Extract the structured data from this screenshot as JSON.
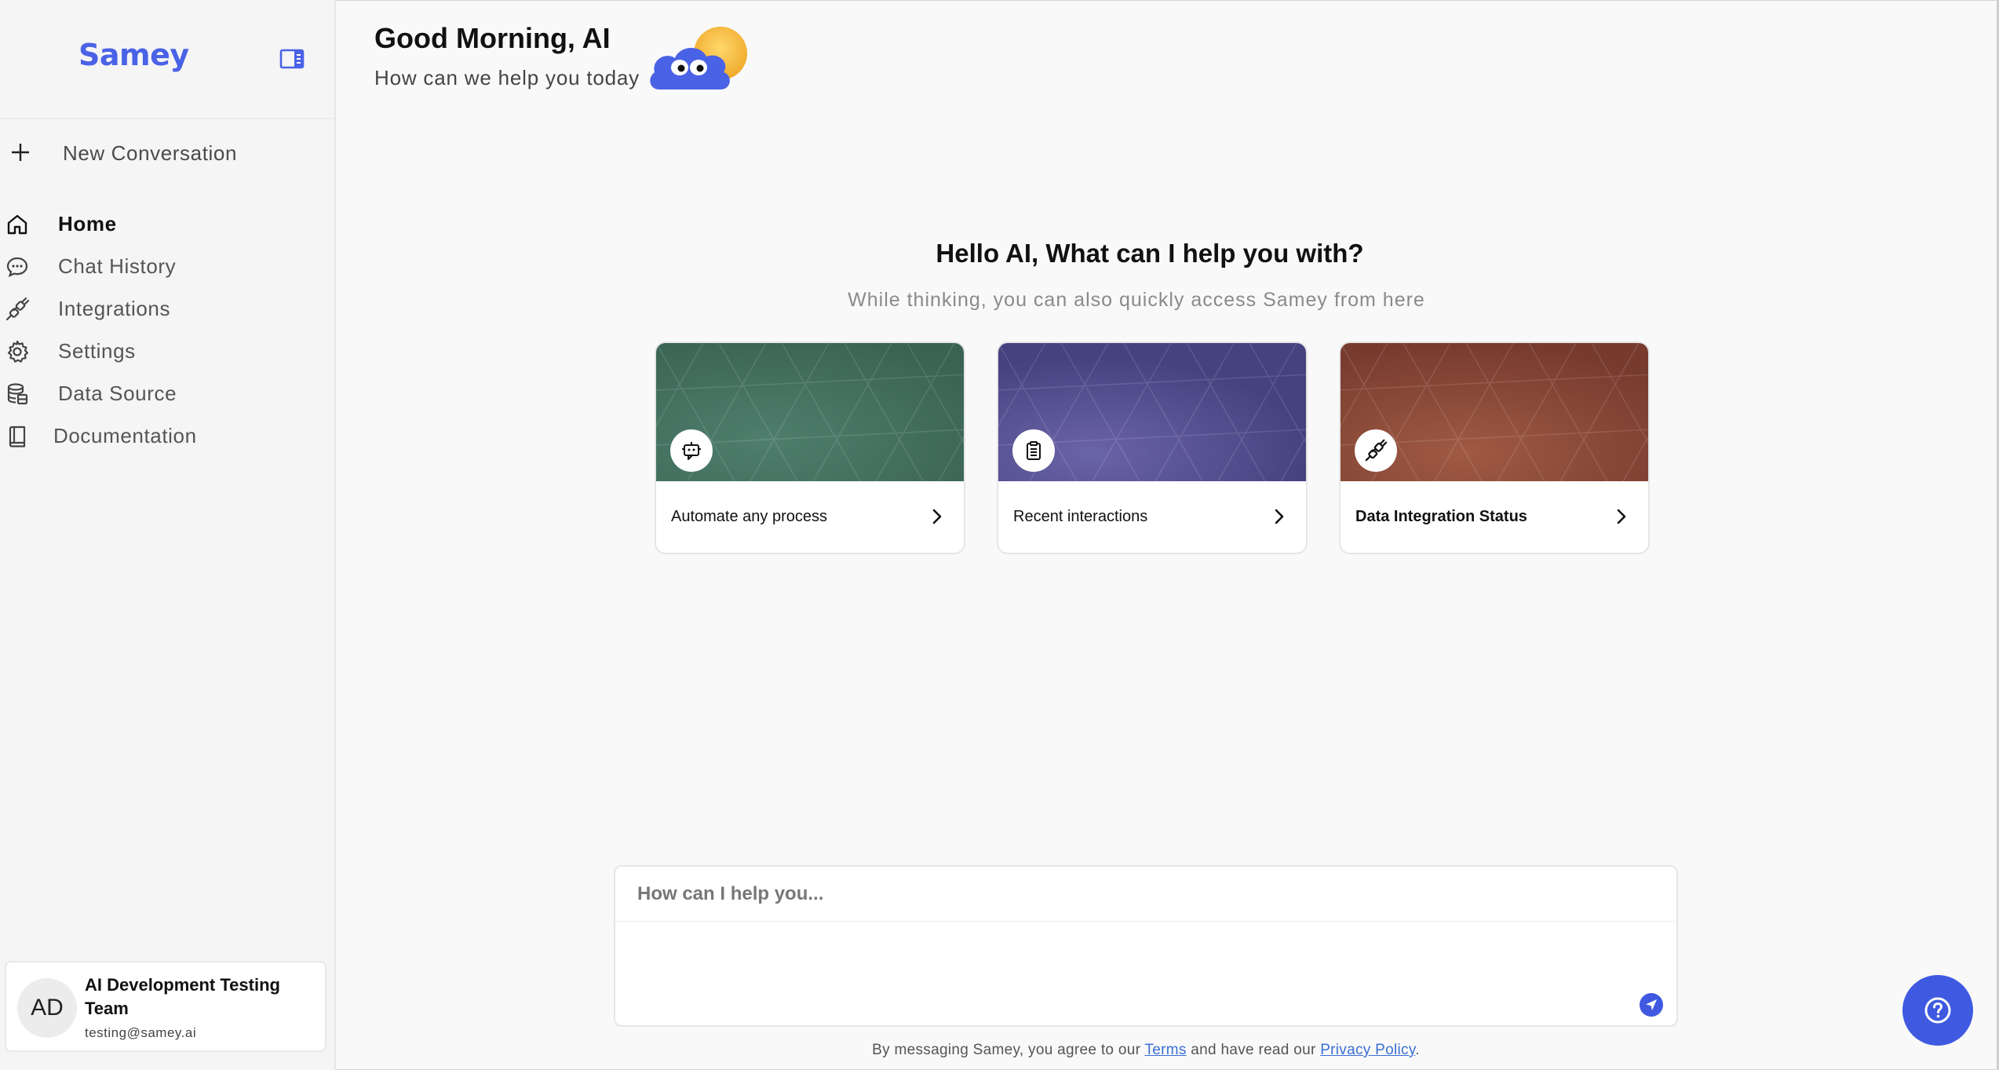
{
  "brand": {
    "name": "Samey"
  },
  "sidebar": {
    "new_conversation": "New Conversation",
    "items": [
      {
        "label": "Home",
        "icon": "home-icon",
        "active": true
      },
      {
        "label": "Chat History",
        "icon": "chat-bubble-icon"
      },
      {
        "label": "Integrations",
        "icon": "plug-icon"
      },
      {
        "label": "Settings",
        "icon": "gear-icon"
      },
      {
        "label": "Data Source",
        "icon": "database-icon"
      },
      {
        "label": "Documentation",
        "icon": "book-icon"
      }
    ],
    "user": {
      "initials": "AD",
      "name": "AI Development Testing Team",
      "email": "testing@samey.ai"
    }
  },
  "header": {
    "greeting": "Good Morning, AI",
    "subtitle": "How can we help you today"
  },
  "hero": {
    "title": "Hello AI, What can I help you with?",
    "subtitle": "While thinking, you can also quickly access Samey from here"
  },
  "cards": [
    {
      "label": "Automate any process",
      "icon": "robot-chat-icon",
      "color": "#3f6b5b"
    },
    {
      "label": "Recent interactions",
      "icon": "clipboard-icon",
      "color": "#474382"
    },
    {
      "label": "Data Integration Status",
      "icon": "plug-icon",
      "color": "#7a3f31"
    }
  ],
  "composer": {
    "placeholder": "How can I help you..."
  },
  "footer": {
    "prefix": "By messaging Samey, you agree to our ",
    "terms": "Terms",
    "middle": " and have read our ",
    "privacy": "Privacy Policy",
    "suffix": "."
  },
  "colors": {
    "accent": "#4a62e6",
    "fab": "#3f5ae0"
  }
}
